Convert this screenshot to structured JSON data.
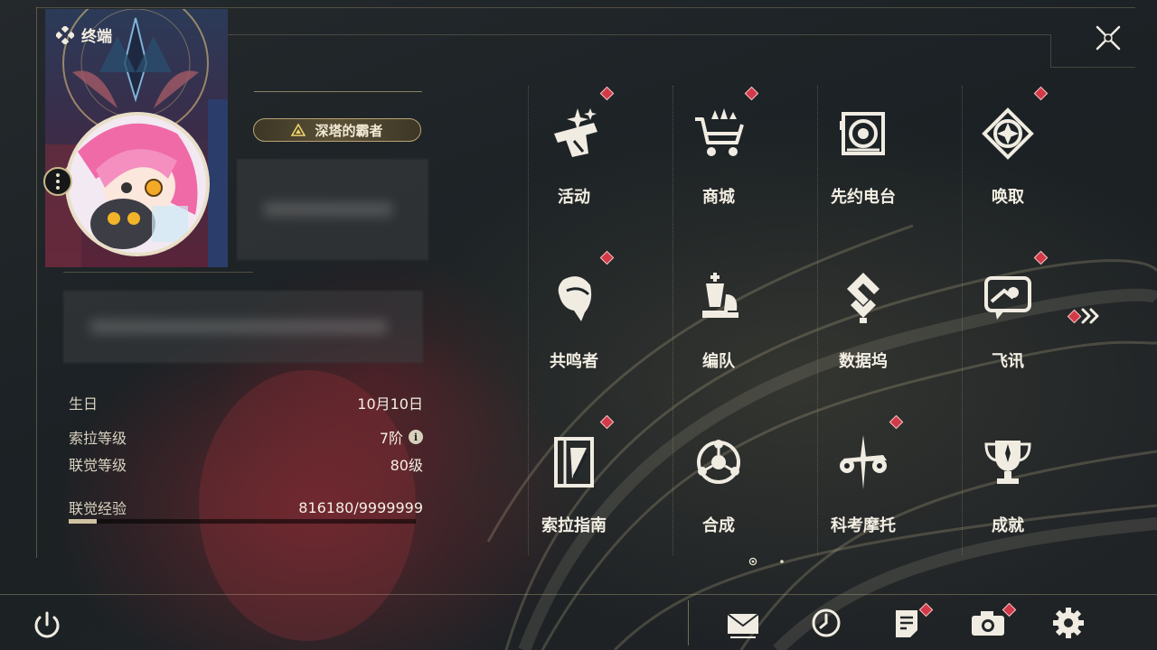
{
  "header": {
    "title": "终端"
  },
  "profile": {
    "title_badge": "深塔的霸者",
    "stats": [
      {
        "label": "生日",
        "value": "10月10日"
      },
      {
        "label": "索拉等级",
        "value": "7阶"
      },
      {
        "label": "联觉等级",
        "value": "80级"
      },
      {
        "label": "联觉经验",
        "value": "816180/9999999"
      }
    ],
    "experience_progress": 0.082
  },
  "menu": {
    "items": [
      {
        "label": "活动",
        "icon": "event-icon",
        "badge": true
      },
      {
        "label": "商城",
        "icon": "shop-cart-icon",
        "badge": true
      },
      {
        "label": "先约电台",
        "icon": "radio-icon",
        "badge": false
      },
      {
        "label": "唤取",
        "icon": "convene-icon",
        "badge": true
      },
      {
        "label": "共鸣者",
        "icon": "resonator-icon",
        "badge": true
      },
      {
        "label": "编队",
        "icon": "chess-team-icon",
        "badge": false
      },
      {
        "label": "数据坞",
        "icon": "databank-icon",
        "badge": false
      },
      {
        "label": "飞讯",
        "icon": "messenger-icon",
        "badge": true
      },
      {
        "label": "索拉指南",
        "icon": "guidebook-icon",
        "badge": true
      },
      {
        "label": "合成",
        "icon": "synthesis-icon",
        "badge": false
      },
      {
        "label": "科考摩托",
        "icon": "motorbike-icon",
        "badge": true
      },
      {
        "label": "成就",
        "icon": "trophy-icon",
        "badge": false
      }
    ],
    "pages": 2,
    "current_page": 1
  },
  "bottom_bar": {
    "icons": [
      "power-icon",
      "mail-icon",
      "clock-icon",
      "notes-icon",
      "camera-icon",
      "settings-gear-icon"
    ]
  },
  "colors": {
    "accent": "#cbb88a",
    "badge": "#d23a49",
    "text": "#f3eee3"
  }
}
